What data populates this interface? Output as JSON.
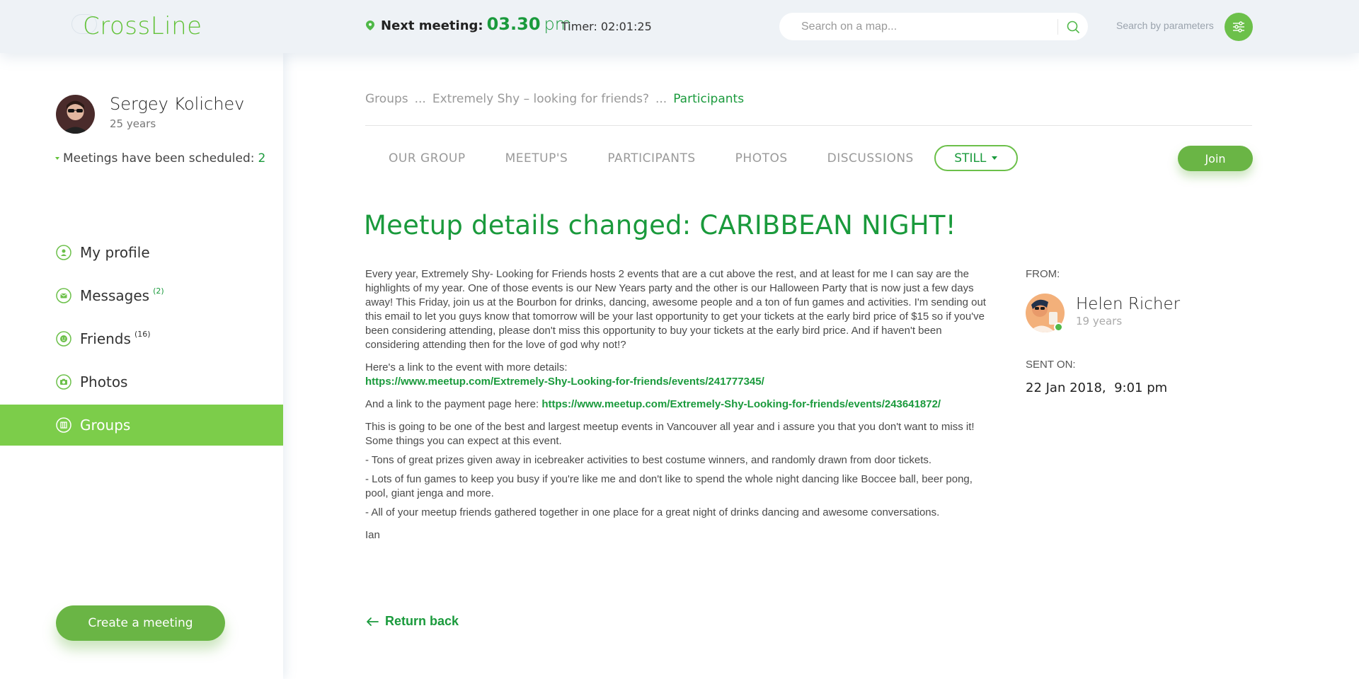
{
  "header": {
    "logo": "CrossLine",
    "next_meeting_label": "Next meeting:",
    "next_meeting_time": "03.30",
    "next_meeting_unit": "pm",
    "timer": "Timer: 02:01:25",
    "search_placeholder": "Search on a map...",
    "search_params_label": "Search by parameters",
    "accent_color": "#6cc04a"
  },
  "sidebar": {
    "user_name": "Sergey Kolichev",
    "user_age": "25 years",
    "scheduled_label": "Meetings have been scheduled:",
    "scheduled_count": "2",
    "items": [
      {
        "label": "My profile",
        "icon": "user-icon",
        "badge": ""
      },
      {
        "label": "Messages",
        "icon": "envelope-icon",
        "badge": "(2)"
      },
      {
        "label": "Friends",
        "icon": "smile-icon",
        "badge": "(16)"
      },
      {
        "label": "Photos",
        "icon": "camera-icon",
        "badge": ""
      },
      {
        "label": "Groups",
        "icon": "groups-icon",
        "badge": "",
        "active": true
      }
    ],
    "create_button": "Create a meeting"
  },
  "breadcrumb": {
    "root": "Groups",
    "sep1": "...",
    "group": "Extremely Shy – looking for friends?",
    "sep2": "...",
    "current": "Participants"
  },
  "tabs": {
    "items": [
      "OUR GROUP",
      "MEETUP'S",
      "PARTICIPANTS",
      "PHOTOS",
      "DISCUSSIONS"
    ],
    "still": "STILL",
    "join": "Join"
  },
  "message": {
    "title": "Meetup details changed: CARIBBEAN NIGHT!",
    "p1": "Every year, Extremely Shy- Looking for Friends hosts 2 events that are a cut above the rest, and at least for me I can say are the highlights of my year. One of those events is our New Years party and the other is our Halloween Party that is now just a few days away! This Friday, join us at the Bourbon for drinks, dancing, awesome people and a ton of fun games and activities. I'm sending out this email to let you guys know that tomorrow will be your last opportunity to get your tickets at the early bird price of $15 so if you've been considering attending, please don't miss this opportunity to buy your tickets at the early bird price. And if haven't been considering attending then for the love of god why not!?",
    "p2_text": "Here's a link to the event with more details:",
    "p2_link": "https://www.meetup.com/Extremely-Shy-Looking-for-friends/events/241777345/",
    "p3_text": "And a link to the payment page here:",
    "p3_link": "https://www.meetup.com/Extremely-Shy-Looking-for-friends/events/243641872/",
    "p4": "This is going to be one of the best and largest meetup events in Vancouver all year and i assure you that you don't want to miss it! Some things you can expect at this event.",
    "p5": "- Tons of great prizes given away in icebreaker activities to best costume winners, and randomly drawn from door tickets.",
    "p6": "- Lots of fun games to keep you busy if you're like me and don't like to spend the whole night dancing like Boccee ball, beer pong, pool, giant jenga and more.",
    "p7": "- All of your meetup friends gathered together in one place for a great night of drinks dancing and awesome conversations.",
    "signature": "Ian"
  },
  "sender": {
    "from_label": "FROM:",
    "name": "Helen Richer",
    "age": "19 years",
    "sent_label": "SENT ON:",
    "sent_date": "22 Jan 2018,  9:01 pm"
  },
  "footer": {
    "return_label": "Return back"
  }
}
